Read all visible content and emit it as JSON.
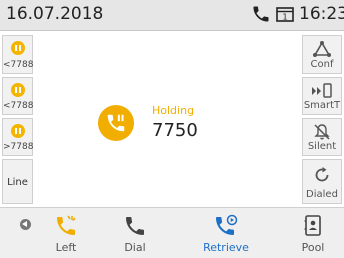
{
  "status": {
    "date": "16.07.2018",
    "time": "16:23",
    "icons": [
      "phone-icon",
      "line-status-icon"
    ]
  },
  "line_keys": [
    {
      "label": "<7788",
      "state": "held",
      "color": "#f5b400"
    },
    {
      "label": "<7788",
      "state": "held",
      "color": "#f5b400"
    },
    {
      "label": ">7788",
      "state": "held",
      "color": "#f5b400"
    },
    {
      "label": "Line",
      "state": "idle"
    }
  ],
  "soft_keys": [
    {
      "label": "Conf",
      "icon": "conference-icon"
    },
    {
      "label": "SmartT",
      "icon": "smart-transfer-icon"
    },
    {
      "label": "Silent",
      "icon": "bell-off-icon"
    },
    {
      "label": "Dialed",
      "icon": "refresh-icon"
    }
  ],
  "call": {
    "status_label": "Holding",
    "number": "7750",
    "accent": "#f2ae00"
  },
  "bottom": {
    "buttons": [
      {
        "label": "Left",
        "icon": "phone-ringing-icon",
        "color": "#f2ae00"
      },
      {
        "label": "Dial",
        "icon": "handset-icon",
        "color": "#444444"
      },
      {
        "label": "Retrieve",
        "icon": "phone-resume-icon",
        "color": "#1e6fc6",
        "active": true
      },
      {
        "label": "Pool",
        "icon": "contacts-icon",
        "color": "#444444"
      }
    ]
  }
}
